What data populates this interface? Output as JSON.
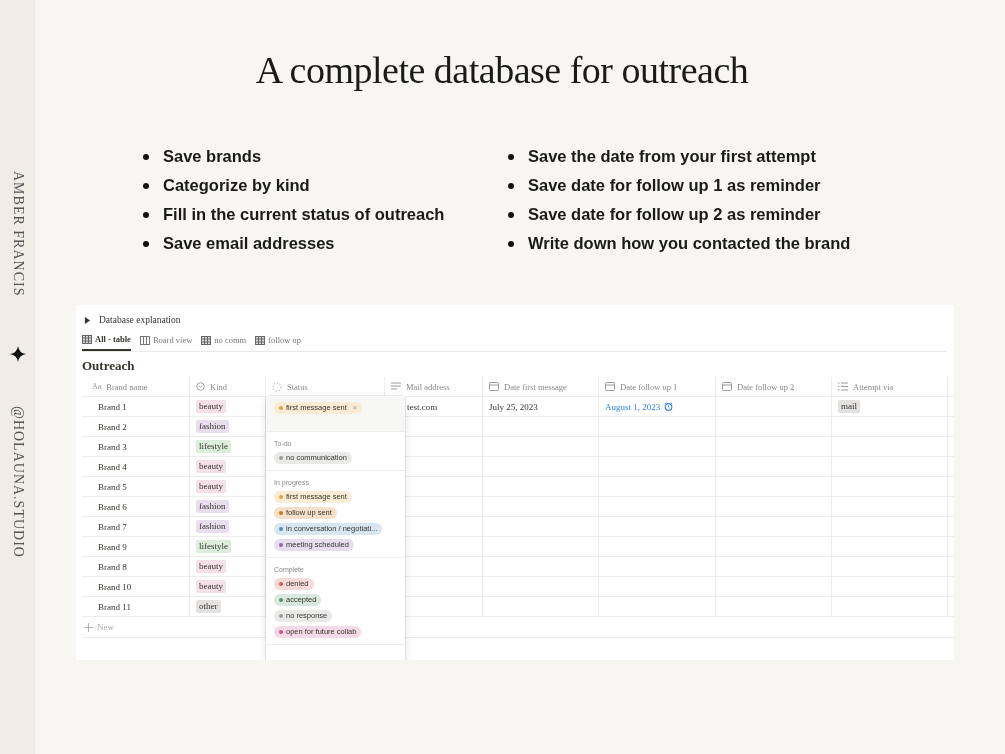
{
  "sidebar": {
    "author": "AMBER FRANCIS",
    "handle": "@HOLAUNA.STUDIO"
  },
  "title": "A complete database for outreach",
  "bullets_left": [
    "Save brands",
    "Categorize by kind",
    "Fill in the current status of outreach",
    "Save email addresses"
  ],
  "bullets_right": [
    "Save the date from your first attempt",
    "Save date for follow up  1 as reminder",
    "Save date for follow up 2 as reminder",
    "Write down how you contacted the brand"
  ],
  "app": {
    "toggle": {
      "label": "Database explanation",
      "expanded": false
    },
    "views": [
      {
        "label": "All - table",
        "kind": "table",
        "selected": true
      },
      {
        "label": "Board view",
        "kind": "board",
        "selected": false
      },
      {
        "label": "no comm",
        "kind": "table",
        "selected": false
      },
      {
        "label": "follow up",
        "kind": "table",
        "selected": false
      }
    ],
    "database_title": "Outreach",
    "columns": [
      {
        "label": "Brand name",
        "kind": "text",
        "glyph": "Aa"
      },
      {
        "label": "Kind",
        "kind": "select"
      },
      {
        "label": "Status",
        "kind": "status"
      },
      {
        "label": "Mail address",
        "kind": "lines"
      },
      {
        "label": "Date first message",
        "kind": "date"
      },
      {
        "label": "Date follow up 1",
        "kind": "date"
      },
      {
        "label": "Date follow up 2",
        "kind": "date"
      },
      {
        "label": "Attempt via",
        "kind": "list"
      }
    ],
    "rows": [
      {
        "brand": "Brand 1",
        "kind": {
          "label": "beauty",
          "color": "#f5e0e9"
        },
        "mail": "test.com",
        "date_first": "July 25, 2023",
        "follow_up_1": {
          "text": "August 1, 2023",
          "reminder": true
        },
        "attempt": "mail"
      },
      {
        "brand": "Brand 2",
        "kind": {
          "label": "fashion",
          "color": "#e8deee"
        }
      },
      {
        "brand": "Brand 3",
        "kind": {
          "label": "lifestyle",
          "color": "#dbeddb"
        }
      },
      {
        "brand": "Brand 4",
        "kind": {
          "label": "beauty",
          "color": "#f5e0e9"
        }
      },
      {
        "brand": "Brand 5",
        "kind": {
          "label": "beauty",
          "color": "#f5e0e9"
        }
      },
      {
        "brand": "Brand 6",
        "kind": {
          "label": "fashion",
          "color": "#e8deee"
        }
      },
      {
        "brand": "Brand 7",
        "kind": {
          "label": "fashion",
          "color": "#e8deee"
        }
      },
      {
        "brand": "Brand 9",
        "kind": {
          "label": "lifestyle",
          "color": "#dbeddb"
        }
      },
      {
        "brand": "Brand 8",
        "kind": {
          "label": "beauty",
          "color": "#f5e0e9"
        }
      },
      {
        "brand": "Brand 10",
        "kind": {
          "label": "beauty",
          "color": "#f5e0e9"
        }
      },
      {
        "brand": "Brand 11",
        "kind": {
          "label": "other",
          "color": "#e3e2e0"
        }
      }
    ],
    "new_row": "New",
    "status_menu": {
      "current": {
        "label": "first message sent",
        "color": "#e9a23b"
      },
      "remove": "×",
      "groups": [
        {
          "title": "To-do",
          "options": [
            {
              "label": "no communication",
              "color": "#9b9a97"
            }
          ]
        },
        {
          "title": "In progress",
          "options": [
            {
              "label": "first message sent",
              "color": "#e9a23b"
            },
            {
              "label": "follow up sent",
              "color": "#d9730d"
            },
            {
              "label": "in conversation / negotiati...",
              "color": "#4c8fc4"
            },
            {
              "label": "meeting scheduled",
              "color": "#9065b0"
            }
          ]
        },
        {
          "title": "Complete",
          "options": [
            {
              "label": "denied",
              "color": "#e0564f"
            },
            {
              "label": "accepted",
              "color": "#4f9768"
            },
            {
              "label": "no response",
              "color": "#9b9a97"
            },
            {
              "label": "open for future collab",
              "color": "#d1508d"
            }
          ]
        }
      ]
    }
  }
}
